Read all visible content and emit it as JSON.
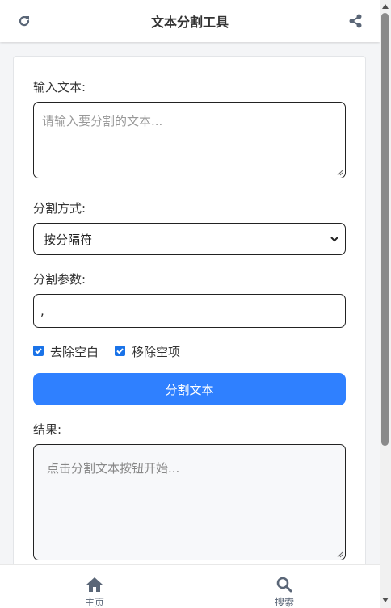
{
  "header": {
    "title": "文本分割工具",
    "left_icon": "refresh-icon",
    "right_icon": "share-icon"
  },
  "form": {
    "input_label": "输入文本:",
    "input_placeholder": "请输入要分割的文本...",
    "method_label": "分割方式:",
    "method_selected": "按分隔符",
    "param_label": "分割参数:",
    "param_value": ",",
    "options": [
      {
        "label": "去除空白",
        "checked": true
      },
      {
        "label": "移除空项",
        "checked": true
      }
    ],
    "split_button": "分割文本",
    "result_label": "结果:",
    "result_placeholder": "点击分割文本按钮开始..."
  },
  "nav": {
    "items": [
      {
        "label": "主页",
        "icon": "home-icon"
      },
      {
        "label": "搜索",
        "icon": "search-icon"
      }
    ]
  },
  "colors": {
    "accent": "#2f80ff",
    "checkbox": "#1a73e8",
    "icon": "#5a6677"
  }
}
